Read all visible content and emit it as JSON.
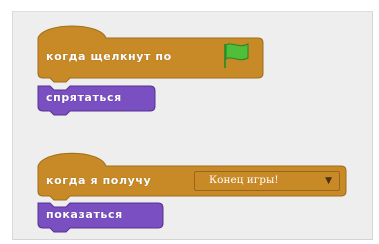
{
  "colors": {
    "events_block": "#c88a26",
    "events_block_dark": "#a06c1c",
    "looks_block": "#7a4fc2",
    "looks_block_dark": "#55328f",
    "canvas_bg": "#eeeeee",
    "flag": "#4fbf3a"
  },
  "script1": {
    "hat_label": "когда щелкнут по",
    "flag_icon": "green-flag-icon",
    "stack_label": "спрятаться"
  },
  "script2": {
    "hat_label": "когда я получу",
    "message_value": "Конец игры!",
    "dropdown_icon": "triangle-down",
    "stack_label": "показаться"
  }
}
